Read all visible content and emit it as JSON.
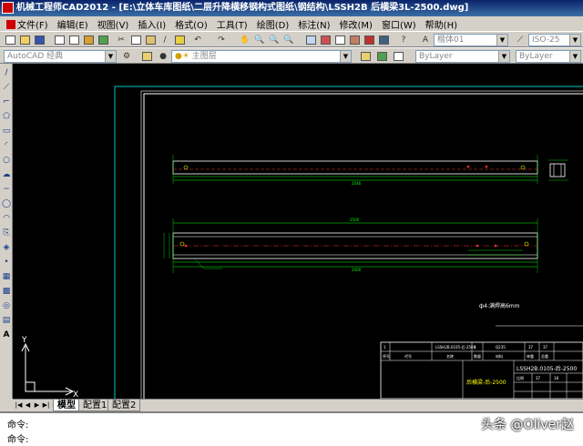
{
  "window": {
    "title": "机械工程师CAD2012 - [E:\\立体车库图纸\\二层升降横移钢构式图纸\\钢结构\\LSSH2B 后横梁3L-2500.dwg]"
  },
  "menu": [
    "文件(F)",
    "编辑(E)",
    "视图(V)",
    "插入(I)",
    "格式(O)",
    "工具(T)",
    "绘图(D)",
    "标注(N)",
    "修改(M)",
    "窗口(W)",
    "帮助(H)"
  ],
  "toolbar1": {
    "text_style": "楷体01",
    "dim_style": "ISO-25"
  },
  "toolbar2": {
    "workspace": "AutoCAD 经典",
    "layer": "主图层",
    "color": "ByLayer",
    "linetype": "ByLayer"
  },
  "drawing": {
    "note": "ф4:满焊高6mm",
    "title_block": {
      "drawing_no": "LSSH2B.0105-后-2500",
      "part_name": "后横梁-后-2500",
      "cell_qty": "1",
      "cell_part": "LSSH2B.0105-后-2500",
      "cell_material": "Q235",
      "cell_a": "1",
      "cell_b": "37",
      "cell_c": "37",
      "col1": "序号",
      "col2": "代号",
      "col3": "名称",
      "col4": "数量",
      "col5": "材料",
      "col6": "单重",
      "col7": "总重",
      "scale_lbl": "比例",
      "weight_val": "37",
      "weight_val2": "18"
    },
    "dims": {
      "top_len": "2500",
      "mid_len1": "2500",
      "mid_len2": "2400",
      "overall": "2546"
    }
  },
  "ucs": {
    "y_label": "Y",
    "x_label": "X"
  },
  "tabs": [
    "模型",
    "配置1",
    "配置2"
  ],
  "command": {
    "line1": "命令:",
    "line2": "命令:"
  },
  "watermark": "头条 @Oliver赵"
}
